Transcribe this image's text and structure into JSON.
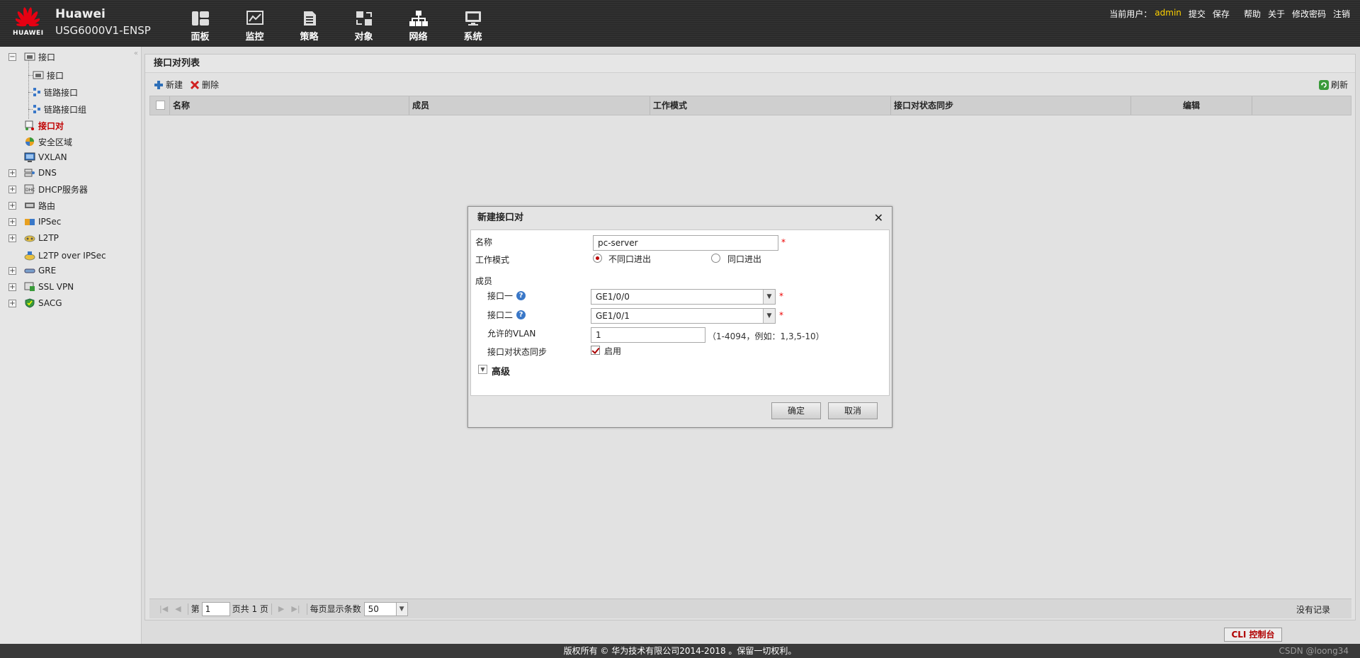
{
  "brand": {
    "logo_text": "HUAWEI",
    "name": "Huawei",
    "model": "USG6000V1-ENSP"
  },
  "nav": [
    {
      "label": "面板",
      "icon": "dashboard-icon"
    },
    {
      "label": "监控",
      "icon": "monitor-icon"
    },
    {
      "label": "策略",
      "icon": "policy-icon"
    },
    {
      "label": "对象",
      "icon": "object-icon"
    },
    {
      "label": "网络",
      "icon": "network-icon"
    },
    {
      "label": "系统",
      "icon": "system-icon"
    }
  ],
  "toplinks": {
    "user_label": "当前用户：",
    "user": "admin",
    "submit": "提交",
    "save": "保存",
    "help": "帮助",
    "about": "关于",
    "change_password": "修改密码",
    "logout": "注销"
  },
  "sidebar": {
    "items": [
      {
        "label": "接口",
        "expander": "−"
      },
      {
        "label": "接口"
      },
      {
        "label": "链路接口"
      },
      {
        "label": "链路接口组"
      },
      {
        "label": "接口对",
        "active": true
      },
      {
        "label": "安全区域"
      },
      {
        "label": "VXLAN"
      },
      {
        "label": "DNS",
        "expander": "+"
      },
      {
        "label": "DHCP服务器",
        "expander": "+"
      },
      {
        "label": "路由",
        "expander": "+"
      },
      {
        "label": "IPSec",
        "expander": "+"
      },
      {
        "label": "L2TP",
        "expander": "+"
      },
      {
        "label": "L2TP over IPSec"
      },
      {
        "label": "GRE",
        "expander": "+"
      },
      {
        "label": "SSL VPN",
        "expander": "+"
      },
      {
        "label": "SACG",
        "expander": "+"
      }
    ]
  },
  "main": {
    "title": "接口对列表",
    "toolbar": {
      "new": "新建",
      "delete": "删除",
      "refresh": "刷新"
    },
    "columns": [
      "名称",
      "成员",
      "工作模式",
      "接口对状态同步",
      "编辑"
    ],
    "pager": {
      "page_prefix": "第",
      "page": "1",
      "page_suffix": "页共 1 页",
      "per_page_label": "每页显示条数",
      "per_page": "50",
      "status": "没有记录"
    }
  },
  "dialog": {
    "title": "新建接口对",
    "close": "✕",
    "name_label": "名称",
    "name_value": "pc-server",
    "mode_label": "工作模式",
    "mode_options": [
      "不同口进出",
      "同口进出"
    ],
    "mode_selected": "不同口进出",
    "members_label": "成员",
    "if1_label": "接口一",
    "if1_value": "GE1/0/0",
    "if2_label": "接口二",
    "if2_value": "GE1/0/1",
    "vlan_label": "允许的VLAN",
    "vlan_value": "1",
    "vlan_hint": "（1-4094，例如：1,3,5-10）",
    "sync_label": "接口对状态同步",
    "sync_option": "启用",
    "sync_checked": true,
    "advanced_label": "高级",
    "required_mark": "*",
    "help_mark": "?",
    "ok": "确定",
    "cancel": "取消"
  },
  "footer": {
    "cli": "CLI 控制台",
    "copyright": "版权所有 © 华为技术有限公司2014-2018 。保留一切权利。",
    "watermark": "CSDN @loong34"
  },
  "colors": {
    "accent_red": "#c00000",
    "user_yellow": "#ffd200",
    "help_blue": "#3a78c8"
  }
}
